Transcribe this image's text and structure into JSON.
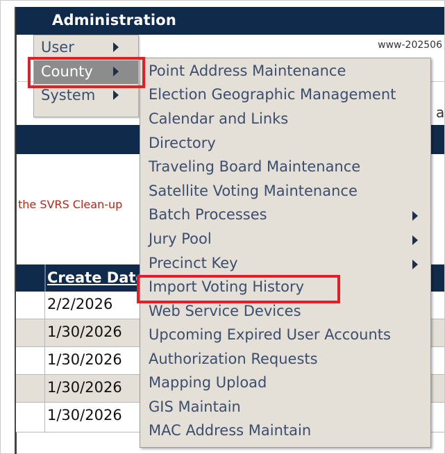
{
  "header": {
    "title": "Administration",
    "server": "www-202506"
  },
  "page": {
    "partial_letter": "a",
    "cleanup_text": "the SVRS Clean-up"
  },
  "table": {
    "column": "Create Date",
    "rows": [
      "2/2/2026",
      "1/30/2026",
      "1/30/2026",
      "1/30/2026",
      "1/30/2026"
    ]
  },
  "menu": {
    "items": [
      {
        "label": "User",
        "active": false
      },
      {
        "label": "County",
        "active": true
      },
      {
        "label": "System",
        "active": false
      }
    ]
  },
  "submenu": {
    "items": [
      {
        "label": "Point Address Maintenance",
        "has_sub": false
      },
      {
        "label": "Election Geographic Management",
        "has_sub": false
      },
      {
        "label": "Calendar and Links",
        "has_sub": false
      },
      {
        "label": "Directory",
        "has_sub": false
      },
      {
        "label": "Traveling Board Maintenance",
        "has_sub": false
      },
      {
        "label": "Satellite Voting Maintenance",
        "has_sub": false
      },
      {
        "label": "Batch Processes",
        "has_sub": true
      },
      {
        "label": "Jury Pool",
        "has_sub": true
      },
      {
        "label": "Precinct Key",
        "has_sub": true
      },
      {
        "label": "Import Voting History",
        "has_sub": false,
        "highlighted": true
      },
      {
        "label": "Web Service Devices",
        "has_sub": false
      },
      {
        "label": "Upcoming Expired User Accounts",
        "has_sub": false
      },
      {
        "label": "Authorization Requests",
        "has_sub": false
      },
      {
        "label": "Mapping Upload",
        "has_sub": false
      },
      {
        "label": "GIS Maintain",
        "has_sub": false
      },
      {
        "label": "MAC Address Maintain",
        "has_sub": false
      }
    ]
  },
  "colors": {
    "navy": "#102a4c",
    "menu_bg": "#e4e0d8",
    "menu_text": "#3b4e6d",
    "highlight": "#e21f26",
    "alert_text": "#b02a1a"
  }
}
